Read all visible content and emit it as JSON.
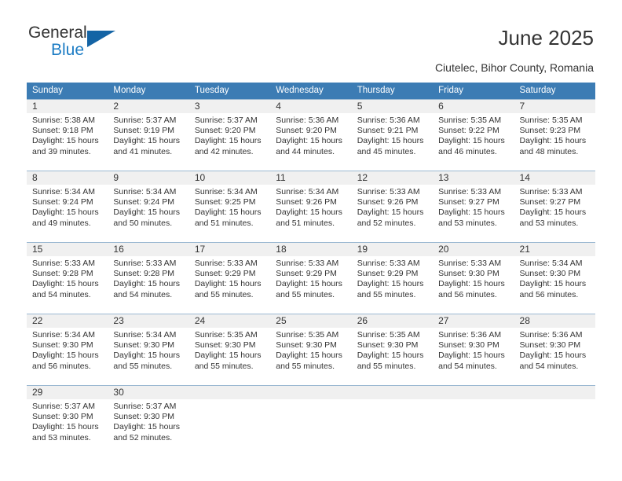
{
  "brand": {
    "name_top": "General",
    "name_bottom": "Blue",
    "accent_color": "#1c7cc4"
  },
  "header": {
    "title": "June 2025",
    "subtitle": "Ciutelec, Bihor County, Romania"
  },
  "calendar": {
    "header_color": "#3c7cb4",
    "weekdays": [
      "Sunday",
      "Monday",
      "Tuesday",
      "Wednesday",
      "Thursday",
      "Friday",
      "Saturday"
    ],
    "labels": {
      "sunrise": "Sunrise:",
      "sunset": "Sunset:",
      "daylight": "Daylight:"
    },
    "weeks": [
      [
        {
          "day": "1",
          "sunrise": "Sunrise: 5:38 AM",
          "sunset": "Sunset: 9:18 PM",
          "daylight_1": "Daylight: 15 hours",
          "daylight_2": "and 39 minutes."
        },
        {
          "day": "2",
          "sunrise": "Sunrise: 5:37 AM",
          "sunset": "Sunset: 9:19 PM",
          "daylight_1": "Daylight: 15 hours",
          "daylight_2": "and 41 minutes."
        },
        {
          "day": "3",
          "sunrise": "Sunrise: 5:37 AM",
          "sunset": "Sunset: 9:20 PM",
          "daylight_1": "Daylight: 15 hours",
          "daylight_2": "and 42 minutes."
        },
        {
          "day": "4",
          "sunrise": "Sunrise: 5:36 AM",
          "sunset": "Sunset: 9:20 PM",
          "daylight_1": "Daylight: 15 hours",
          "daylight_2": "and 44 minutes."
        },
        {
          "day": "5",
          "sunrise": "Sunrise: 5:36 AM",
          "sunset": "Sunset: 9:21 PM",
          "daylight_1": "Daylight: 15 hours",
          "daylight_2": "and 45 minutes."
        },
        {
          "day": "6",
          "sunrise": "Sunrise: 5:35 AM",
          "sunset": "Sunset: 9:22 PM",
          "daylight_1": "Daylight: 15 hours",
          "daylight_2": "and 46 minutes."
        },
        {
          "day": "7",
          "sunrise": "Sunrise: 5:35 AM",
          "sunset": "Sunset: 9:23 PM",
          "daylight_1": "Daylight: 15 hours",
          "daylight_2": "and 48 minutes."
        }
      ],
      [
        {
          "day": "8",
          "sunrise": "Sunrise: 5:34 AM",
          "sunset": "Sunset: 9:24 PM",
          "daylight_1": "Daylight: 15 hours",
          "daylight_2": "and 49 minutes."
        },
        {
          "day": "9",
          "sunrise": "Sunrise: 5:34 AM",
          "sunset": "Sunset: 9:24 PM",
          "daylight_1": "Daylight: 15 hours",
          "daylight_2": "and 50 minutes."
        },
        {
          "day": "10",
          "sunrise": "Sunrise: 5:34 AM",
          "sunset": "Sunset: 9:25 PM",
          "daylight_1": "Daylight: 15 hours",
          "daylight_2": "and 51 minutes."
        },
        {
          "day": "11",
          "sunrise": "Sunrise: 5:34 AM",
          "sunset": "Sunset: 9:26 PM",
          "daylight_1": "Daylight: 15 hours",
          "daylight_2": "and 51 minutes."
        },
        {
          "day": "12",
          "sunrise": "Sunrise: 5:33 AM",
          "sunset": "Sunset: 9:26 PM",
          "daylight_1": "Daylight: 15 hours",
          "daylight_2": "and 52 minutes."
        },
        {
          "day": "13",
          "sunrise": "Sunrise: 5:33 AM",
          "sunset": "Sunset: 9:27 PM",
          "daylight_1": "Daylight: 15 hours",
          "daylight_2": "and 53 minutes."
        },
        {
          "day": "14",
          "sunrise": "Sunrise: 5:33 AM",
          "sunset": "Sunset: 9:27 PM",
          "daylight_1": "Daylight: 15 hours",
          "daylight_2": "and 53 minutes."
        }
      ],
      [
        {
          "day": "15",
          "sunrise": "Sunrise: 5:33 AM",
          "sunset": "Sunset: 9:28 PM",
          "daylight_1": "Daylight: 15 hours",
          "daylight_2": "and 54 minutes."
        },
        {
          "day": "16",
          "sunrise": "Sunrise: 5:33 AM",
          "sunset": "Sunset: 9:28 PM",
          "daylight_1": "Daylight: 15 hours",
          "daylight_2": "and 54 minutes."
        },
        {
          "day": "17",
          "sunrise": "Sunrise: 5:33 AM",
          "sunset": "Sunset: 9:29 PM",
          "daylight_1": "Daylight: 15 hours",
          "daylight_2": "and 55 minutes."
        },
        {
          "day": "18",
          "sunrise": "Sunrise: 5:33 AM",
          "sunset": "Sunset: 9:29 PM",
          "daylight_1": "Daylight: 15 hours",
          "daylight_2": "and 55 minutes."
        },
        {
          "day": "19",
          "sunrise": "Sunrise: 5:33 AM",
          "sunset": "Sunset: 9:29 PM",
          "daylight_1": "Daylight: 15 hours",
          "daylight_2": "and 55 minutes."
        },
        {
          "day": "20",
          "sunrise": "Sunrise: 5:33 AM",
          "sunset": "Sunset: 9:30 PM",
          "daylight_1": "Daylight: 15 hours",
          "daylight_2": "and 56 minutes."
        },
        {
          "day": "21",
          "sunrise": "Sunrise: 5:34 AM",
          "sunset": "Sunset: 9:30 PM",
          "daylight_1": "Daylight: 15 hours",
          "daylight_2": "and 56 minutes."
        }
      ],
      [
        {
          "day": "22",
          "sunrise": "Sunrise: 5:34 AM",
          "sunset": "Sunset: 9:30 PM",
          "daylight_1": "Daylight: 15 hours",
          "daylight_2": "and 56 minutes."
        },
        {
          "day": "23",
          "sunrise": "Sunrise: 5:34 AM",
          "sunset": "Sunset: 9:30 PM",
          "daylight_1": "Daylight: 15 hours",
          "daylight_2": "and 55 minutes."
        },
        {
          "day": "24",
          "sunrise": "Sunrise: 5:35 AM",
          "sunset": "Sunset: 9:30 PM",
          "daylight_1": "Daylight: 15 hours",
          "daylight_2": "and 55 minutes."
        },
        {
          "day": "25",
          "sunrise": "Sunrise: 5:35 AM",
          "sunset": "Sunset: 9:30 PM",
          "daylight_1": "Daylight: 15 hours",
          "daylight_2": "and 55 minutes."
        },
        {
          "day": "26",
          "sunrise": "Sunrise: 5:35 AM",
          "sunset": "Sunset: 9:30 PM",
          "daylight_1": "Daylight: 15 hours",
          "daylight_2": "and 55 minutes."
        },
        {
          "day": "27",
          "sunrise": "Sunrise: 5:36 AM",
          "sunset": "Sunset: 9:30 PM",
          "daylight_1": "Daylight: 15 hours",
          "daylight_2": "and 54 minutes."
        },
        {
          "day": "28",
          "sunrise": "Sunrise: 5:36 AM",
          "sunset": "Sunset: 9:30 PM",
          "daylight_1": "Daylight: 15 hours",
          "daylight_2": "and 54 minutes."
        }
      ],
      [
        {
          "day": "29",
          "sunrise": "Sunrise: 5:37 AM",
          "sunset": "Sunset: 9:30 PM",
          "daylight_1": "Daylight: 15 hours",
          "daylight_2": "and 53 minutes."
        },
        {
          "day": "30",
          "sunrise": "Sunrise: 5:37 AM",
          "sunset": "Sunset: 9:30 PM",
          "daylight_1": "Daylight: 15 hours",
          "daylight_2": "and 52 minutes."
        },
        {
          "day": "",
          "sunrise": "",
          "sunset": "",
          "daylight_1": "",
          "daylight_2": ""
        },
        {
          "day": "",
          "sunrise": "",
          "sunset": "",
          "daylight_1": "",
          "daylight_2": ""
        },
        {
          "day": "",
          "sunrise": "",
          "sunset": "",
          "daylight_1": "",
          "daylight_2": ""
        },
        {
          "day": "",
          "sunrise": "",
          "sunset": "",
          "daylight_1": "",
          "daylight_2": ""
        },
        {
          "day": "",
          "sunrise": "",
          "sunset": "",
          "daylight_1": "",
          "daylight_2": ""
        }
      ]
    ]
  }
}
